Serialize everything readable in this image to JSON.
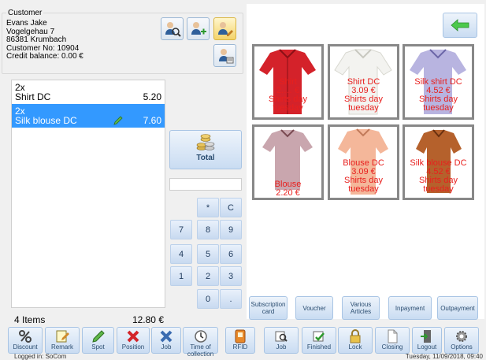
{
  "customer": {
    "legend": "Customer",
    "name": "Evans Jake",
    "street": "Vogelgehau 7",
    "city": "86381 Krumbach",
    "number": "Customer No: 10904",
    "credit": "Credit balance: 0.00 €"
  },
  "orders": [
    {
      "qty": "2x",
      "name": "Shirt DC",
      "price": "5.20"
    },
    {
      "qty": "2x",
      "name": "Silk blouse DC",
      "price": "7.60"
    }
  ],
  "summary": {
    "items": "4 Items",
    "total": "12.80 €"
  },
  "total_button": "Total",
  "keypad": [
    "*",
    "C",
    "7",
    "8",
    "9",
    "4",
    "5",
    "6",
    "1",
    "2",
    "3",
    "0",
    "."
  ],
  "articles": [
    {
      "line1": "Shirt",
      "line2": "2.… €",
      "line3": "Shirts day",
      "line4": "tuesday"
    },
    {
      "line1": "Shirt DC",
      "line2": "3.09 €",
      "line3": "Shirts day",
      "line4": "tuesday"
    },
    {
      "line1": "Silk shirt DC",
      "line2": "4.52 €",
      "line3": "Shirts day",
      "line4": "tuesday"
    },
    {
      "line1": "Blouse",
      "line2": "2.20 €",
      "line3": "",
      "line4": ""
    },
    {
      "line1": "Blouse DC",
      "line2": "3.09 €",
      "line3": "Shirts day",
      "line4": "tuesday"
    },
    {
      "line1": "Silk blouse DC",
      "line2": "4.52 €",
      "line3": "Shirts day",
      "line4": "tuesday"
    }
  ],
  "type_buttons": [
    {
      "label1": "Subscription",
      "label2": "card"
    },
    {
      "label1": "Voucher",
      "label2": ""
    },
    {
      "label1": "Various",
      "label2": "Articles"
    },
    {
      "label1": "Inpayment",
      "label2": ""
    },
    {
      "label1": "Outpayment",
      "label2": ""
    }
  ],
  "toolbar": [
    "Discount",
    "Remark",
    "Spot",
    "Position",
    "Job",
    "Time of collection",
    "RFID",
    "Job",
    "Finished",
    "Lock",
    "Closing",
    "Logout",
    "Options"
  ],
  "status": {
    "left": "Logged in:  SoCom",
    "right": "Tuesday, 11/09/2018, 09:40"
  },
  "colors": {
    "accent": "#3399ff",
    "article_text": "#e8201e",
    "tile_border": "#888888"
  }
}
